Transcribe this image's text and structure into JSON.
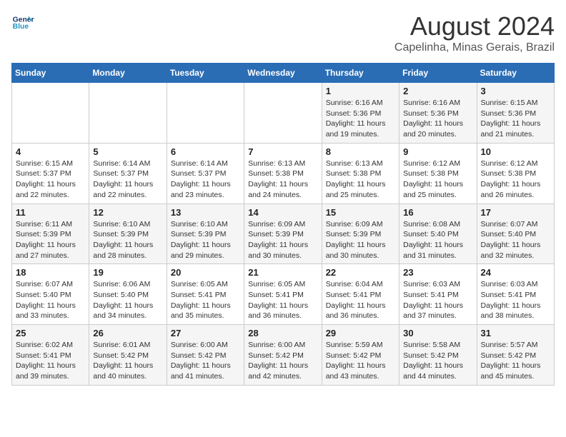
{
  "header": {
    "logo_line1": "General",
    "logo_line2": "Blue",
    "title": "August 2024",
    "subtitle": "Capelinha, Minas Gerais, Brazil"
  },
  "days_of_week": [
    "Sunday",
    "Monday",
    "Tuesday",
    "Wednesday",
    "Thursday",
    "Friday",
    "Saturday"
  ],
  "weeks": [
    [
      {
        "day": "",
        "info": ""
      },
      {
        "day": "",
        "info": ""
      },
      {
        "day": "",
        "info": ""
      },
      {
        "day": "",
        "info": ""
      },
      {
        "day": "1",
        "info": "Sunrise: 6:16 AM\nSunset: 5:36 PM\nDaylight: 11 hours\nand 19 minutes."
      },
      {
        "day": "2",
        "info": "Sunrise: 6:16 AM\nSunset: 5:36 PM\nDaylight: 11 hours\nand 20 minutes."
      },
      {
        "day": "3",
        "info": "Sunrise: 6:15 AM\nSunset: 5:36 PM\nDaylight: 11 hours\nand 21 minutes."
      }
    ],
    [
      {
        "day": "4",
        "info": "Sunrise: 6:15 AM\nSunset: 5:37 PM\nDaylight: 11 hours\nand 22 minutes."
      },
      {
        "day": "5",
        "info": "Sunrise: 6:14 AM\nSunset: 5:37 PM\nDaylight: 11 hours\nand 22 minutes."
      },
      {
        "day": "6",
        "info": "Sunrise: 6:14 AM\nSunset: 5:37 PM\nDaylight: 11 hours\nand 23 minutes."
      },
      {
        "day": "7",
        "info": "Sunrise: 6:13 AM\nSunset: 5:38 PM\nDaylight: 11 hours\nand 24 minutes."
      },
      {
        "day": "8",
        "info": "Sunrise: 6:13 AM\nSunset: 5:38 PM\nDaylight: 11 hours\nand 25 minutes."
      },
      {
        "day": "9",
        "info": "Sunrise: 6:12 AM\nSunset: 5:38 PM\nDaylight: 11 hours\nand 25 minutes."
      },
      {
        "day": "10",
        "info": "Sunrise: 6:12 AM\nSunset: 5:38 PM\nDaylight: 11 hours\nand 26 minutes."
      }
    ],
    [
      {
        "day": "11",
        "info": "Sunrise: 6:11 AM\nSunset: 5:39 PM\nDaylight: 11 hours\nand 27 minutes."
      },
      {
        "day": "12",
        "info": "Sunrise: 6:10 AM\nSunset: 5:39 PM\nDaylight: 11 hours\nand 28 minutes."
      },
      {
        "day": "13",
        "info": "Sunrise: 6:10 AM\nSunset: 5:39 PM\nDaylight: 11 hours\nand 29 minutes."
      },
      {
        "day": "14",
        "info": "Sunrise: 6:09 AM\nSunset: 5:39 PM\nDaylight: 11 hours\nand 30 minutes."
      },
      {
        "day": "15",
        "info": "Sunrise: 6:09 AM\nSunset: 5:39 PM\nDaylight: 11 hours\nand 30 minutes."
      },
      {
        "day": "16",
        "info": "Sunrise: 6:08 AM\nSunset: 5:40 PM\nDaylight: 11 hours\nand 31 minutes."
      },
      {
        "day": "17",
        "info": "Sunrise: 6:07 AM\nSunset: 5:40 PM\nDaylight: 11 hours\nand 32 minutes."
      }
    ],
    [
      {
        "day": "18",
        "info": "Sunrise: 6:07 AM\nSunset: 5:40 PM\nDaylight: 11 hours\nand 33 minutes."
      },
      {
        "day": "19",
        "info": "Sunrise: 6:06 AM\nSunset: 5:40 PM\nDaylight: 11 hours\nand 34 minutes."
      },
      {
        "day": "20",
        "info": "Sunrise: 6:05 AM\nSunset: 5:41 PM\nDaylight: 11 hours\nand 35 minutes."
      },
      {
        "day": "21",
        "info": "Sunrise: 6:05 AM\nSunset: 5:41 PM\nDaylight: 11 hours\nand 36 minutes."
      },
      {
        "day": "22",
        "info": "Sunrise: 6:04 AM\nSunset: 5:41 PM\nDaylight: 11 hours\nand 36 minutes."
      },
      {
        "day": "23",
        "info": "Sunrise: 6:03 AM\nSunset: 5:41 PM\nDaylight: 11 hours\nand 37 minutes."
      },
      {
        "day": "24",
        "info": "Sunrise: 6:03 AM\nSunset: 5:41 PM\nDaylight: 11 hours\nand 38 minutes."
      }
    ],
    [
      {
        "day": "25",
        "info": "Sunrise: 6:02 AM\nSunset: 5:41 PM\nDaylight: 11 hours\nand 39 minutes."
      },
      {
        "day": "26",
        "info": "Sunrise: 6:01 AM\nSunset: 5:42 PM\nDaylight: 11 hours\nand 40 minutes."
      },
      {
        "day": "27",
        "info": "Sunrise: 6:00 AM\nSunset: 5:42 PM\nDaylight: 11 hours\nand 41 minutes."
      },
      {
        "day": "28",
        "info": "Sunrise: 6:00 AM\nSunset: 5:42 PM\nDaylight: 11 hours\nand 42 minutes."
      },
      {
        "day": "29",
        "info": "Sunrise: 5:59 AM\nSunset: 5:42 PM\nDaylight: 11 hours\nand 43 minutes."
      },
      {
        "day": "30",
        "info": "Sunrise: 5:58 AM\nSunset: 5:42 PM\nDaylight: 11 hours\nand 44 minutes."
      },
      {
        "day": "31",
        "info": "Sunrise: 5:57 AM\nSunset: 5:42 PM\nDaylight: 11 hours\nand 45 minutes."
      }
    ]
  ]
}
